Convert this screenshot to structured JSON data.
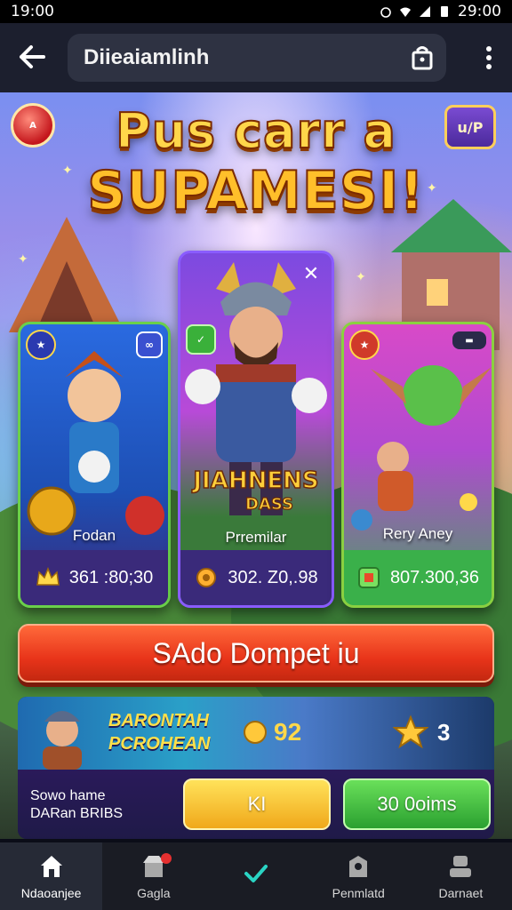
{
  "status_bar": {
    "time": "19:00",
    "right_time": "29:00"
  },
  "app_bar": {
    "title": "Diieaiamlinh"
  },
  "hero": {
    "title_line1": "Pus carr a",
    "title_line2": "SUPAMESI!",
    "left_badge": "A",
    "right_badge": "u/P"
  },
  "cards": [
    {
      "name": "Fodan",
      "value": "361 :80;30",
      "icon": "crown-icon",
      "accent": "#6ad04a"
    },
    {
      "name": "Prremilar",
      "value": "302. Z0,.98",
      "icon": "gear-icon",
      "accent": "#8a5cff",
      "art_text_line1": "JIAHNENS",
      "art_text_line2": "DASS"
    },
    {
      "name": "Rery Aney",
      "value": "807.300,36",
      "icon": "gem-icon",
      "accent": "#8ad040"
    }
  ],
  "cta": {
    "label": "SAdo Dompet iu"
  },
  "promo": {
    "title_line1": "BARONTAH",
    "title_line2": "PCROHEAN",
    "stat1": "92",
    "stat2": "3",
    "text_line1": "Sowo hame",
    "text_line2": "DARan BRIBS",
    "button1": "KI",
    "button2": "30 0oims"
  },
  "bottom_nav": [
    {
      "label": "Ndaoanjee",
      "icon": "home-icon",
      "active": true
    },
    {
      "label": "Gagla",
      "icon": "shop-icon",
      "active": false
    },
    {
      "label": "",
      "icon": "check-icon",
      "active": false
    },
    {
      "label": "Penmlatd",
      "icon": "chest-icon",
      "active": false
    },
    {
      "label": "Darnaet",
      "icon": "profile-icon",
      "active": false
    }
  ],
  "colors": {
    "cta": "#e8341a",
    "title_gold": "#ffbf2a",
    "nav_bg": "#1a1c24",
    "check_teal": "#2ad4c4"
  }
}
